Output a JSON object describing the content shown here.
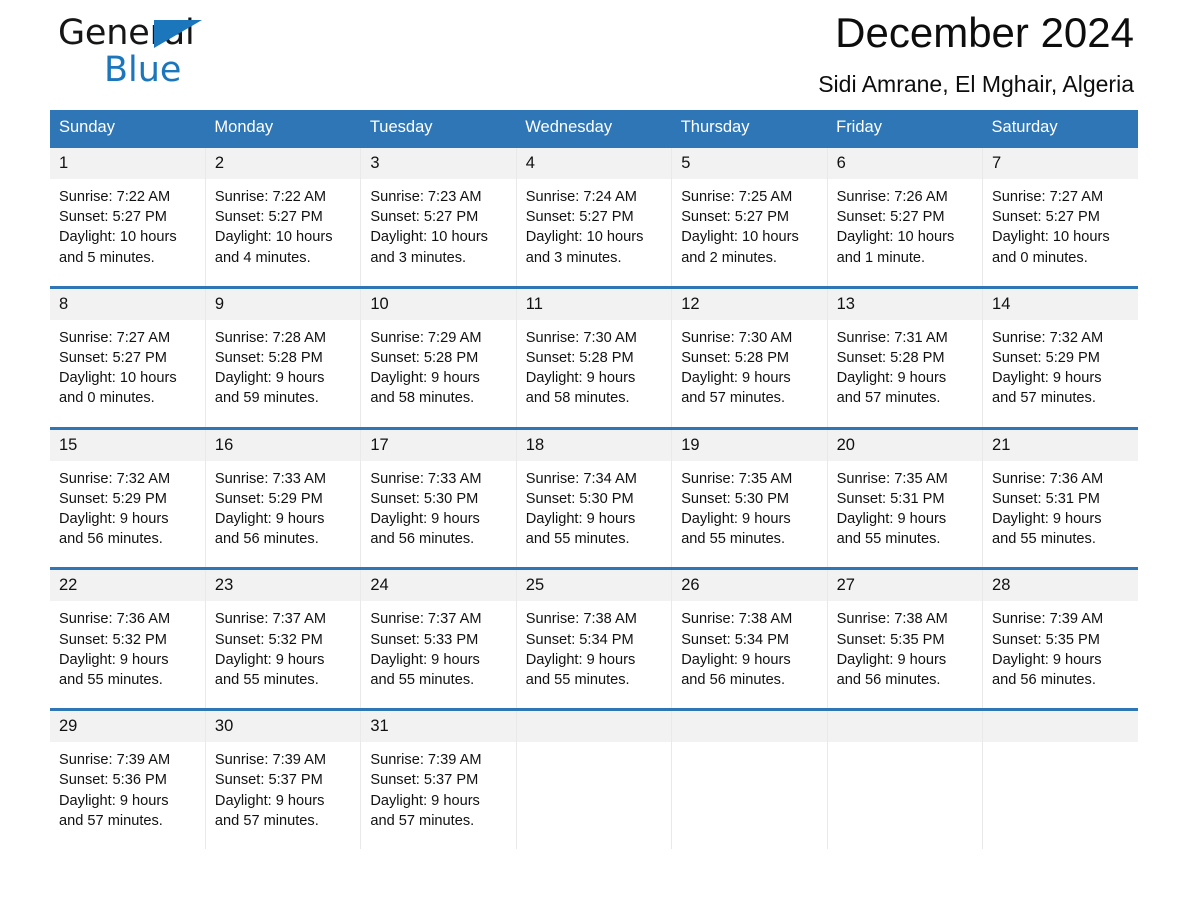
{
  "brand": {
    "name_part1": "General",
    "name_part2": "Blue",
    "triangle_icon": "triangle-icon",
    "accent_color": "#1b76bc"
  },
  "header": {
    "title": "December 2024",
    "subtitle": "Sidi Amrane, El Mghair, Algeria"
  },
  "calendar": {
    "header_bg": "#2e76b6",
    "daynum_bg": "#f2f2f2",
    "weekdays": [
      "Sunday",
      "Monday",
      "Tuesday",
      "Wednesday",
      "Thursday",
      "Friday",
      "Saturday"
    ],
    "weeks": [
      [
        {
          "day": "1",
          "sunrise": "Sunrise: 7:22 AM",
          "sunset": "Sunset: 5:27 PM",
          "daylight_line1": "Daylight: 10 hours",
          "daylight_line2": "and 5 minutes."
        },
        {
          "day": "2",
          "sunrise": "Sunrise: 7:22 AM",
          "sunset": "Sunset: 5:27 PM",
          "daylight_line1": "Daylight: 10 hours",
          "daylight_line2": "and 4 minutes."
        },
        {
          "day": "3",
          "sunrise": "Sunrise: 7:23 AM",
          "sunset": "Sunset: 5:27 PM",
          "daylight_line1": "Daylight: 10 hours",
          "daylight_line2": "and 3 minutes."
        },
        {
          "day": "4",
          "sunrise": "Sunrise: 7:24 AM",
          "sunset": "Sunset: 5:27 PM",
          "daylight_line1": "Daylight: 10 hours",
          "daylight_line2": "and 3 minutes."
        },
        {
          "day": "5",
          "sunrise": "Sunrise: 7:25 AM",
          "sunset": "Sunset: 5:27 PM",
          "daylight_line1": "Daylight: 10 hours",
          "daylight_line2": "and 2 minutes."
        },
        {
          "day": "6",
          "sunrise": "Sunrise: 7:26 AM",
          "sunset": "Sunset: 5:27 PM",
          "daylight_line1": "Daylight: 10 hours",
          "daylight_line2": "and 1 minute."
        },
        {
          "day": "7",
          "sunrise": "Sunrise: 7:27 AM",
          "sunset": "Sunset: 5:27 PM",
          "daylight_line1": "Daylight: 10 hours",
          "daylight_line2": "and 0 minutes."
        }
      ],
      [
        {
          "day": "8",
          "sunrise": "Sunrise: 7:27 AM",
          "sunset": "Sunset: 5:27 PM",
          "daylight_line1": "Daylight: 10 hours",
          "daylight_line2": "and 0 minutes."
        },
        {
          "day": "9",
          "sunrise": "Sunrise: 7:28 AM",
          "sunset": "Sunset: 5:28 PM",
          "daylight_line1": "Daylight: 9 hours",
          "daylight_line2": "and 59 minutes."
        },
        {
          "day": "10",
          "sunrise": "Sunrise: 7:29 AM",
          "sunset": "Sunset: 5:28 PM",
          "daylight_line1": "Daylight: 9 hours",
          "daylight_line2": "and 58 minutes."
        },
        {
          "day": "11",
          "sunrise": "Sunrise: 7:30 AM",
          "sunset": "Sunset: 5:28 PM",
          "daylight_line1": "Daylight: 9 hours",
          "daylight_line2": "and 58 minutes."
        },
        {
          "day": "12",
          "sunrise": "Sunrise: 7:30 AM",
          "sunset": "Sunset: 5:28 PM",
          "daylight_line1": "Daylight: 9 hours",
          "daylight_line2": "and 57 minutes."
        },
        {
          "day": "13",
          "sunrise": "Sunrise: 7:31 AM",
          "sunset": "Sunset: 5:28 PM",
          "daylight_line1": "Daylight: 9 hours",
          "daylight_line2": "and 57 minutes."
        },
        {
          "day": "14",
          "sunrise": "Sunrise: 7:32 AM",
          "sunset": "Sunset: 5:29 PM",
          "daylight_line1": "Daylight: 9 hours",
          "daylight_line2": "and 57 minutes."
        }
      ],
      [
        {
          "day": "15",
          "sunrise": "Sunrise: 7:32 AM",
          "sunset": "Sunset: 5:29 PM",
          "daylight_line1": "Daylight: 9 hours",
          "daylight_line2": "and 56 minutes."
        },
        {
          "day": "16",
          "sunrise": "Sunrise: 7:33 AM",
          "sunset": "Sunset: 5:29 PM",
          "daylight_line1": "Daylight: 9 hours",
          "daylight_line2": "and 56 minutes."
        },
        {
          "day": "17",
          "sunrise": "Sunrise: 7:33 AM",
          "sunset": "Sunset: 5:30 PM",
          "daylight_line1": "Daylight: 9 hours",
          "daylight_line2": "and 56 minutes."
        },
        {
          "day": "18",
          "sunrise": "Sunrise: 7:34 AM",
          "sunset": "Sunset: 5:30 PM",
          "daylight_line1": "Daylight: 9 hours",
          "daylight_line2": "and 55 minutes."
        },
        {
          "day": "19",
          "sunrise": "Sunrise: 7:35 AM",
          "sunset": "Sunset: 5:30 PM",
          "daylight_line1": "Daylight: 9 hours",
          "daylight_line2": "and 55 minutes."
        },
        {
          "day": "20",
          "sunrise": "Sunrise: 7:35 AM",
          "sunset": "Sunset: 5:31 PM",
          "daylight_line1": "Daylight: 9 hours",
          "daylight_line2": "and 55 minutes."
        },
        {
          "day": "21",
          "sunrise": "Sunrise: 7:36 AM",
          "sunset": "Sunset: 5:31 PM",
          "daylight_line1": "Daylight: 9 hours",
          "daylight_line2": "and 55 minutes."
        }
      ],
      [
        {
          "day": "22",
          "sunrise": "Sunrise: 7:36 AM",
          "sunset": "Sunset: 5:32 PM",
          "daylight_line1": "Daylight: 9 hours",
          "daylight_line2": "and 55 minutes."
        },
        {
          "day": "23",
          "sunrise": "Sunrise: 7:37 AM",
          "sunset": "Sunset: 5:32 PM",
          "daylight_line1": "Daylight: 9 hours",
          "daylight_line2": "and 55 minutes."
        },
        {
          "day": "24",
          "sunrise": "Sunrise: 7:37 AM",
          "sunset": "Sunset: 5:33 PM",
          "daylight_line1": "Daylight: 9 hours",
          "daylight_line2": "and 55 minutes."
        },
        {
          "day": "25",
          "sunrise": "Sunrise: 7:38 AM",
          "sunset": "Sunset: 5:34 PM",
          "daylight_line1": "Daylight: 9 hours",
          "daylight_line2": "and 55 minutes."
        },
        {
          "day": "26",
          "sunrise": "Sunrise: 7:38 AM",
          "sunset": "Sunset: 5:34 PM",
          "daylight_line1": "Daylight: 9 hours",
          "daylight_line2": "and 56 minutes."
        },
        {
          "day": "27",
          "sunrise": "Sunrise: 7:38 AM",
          "sunset": "Sunset: 5:35 PM",
          "daylight_line1": "Daylight: 9 hours",
          "daylight_line2": "and 56 minutes."
        },
        {
          "day": "28",
          "sunrise": "Sunrise: 7:39 AM",
          "sunset": "Sunset: 5:35 PM",
          "daylight_line1": "Daylight: 9 hours",
          "daylight_line2": "and 56 minutes."
        }
      ],
      [
        {
          "day": "29",
          "sunrise": "Sunrise: 7:39 AM",
          "sunset": "Sunset: 5:36 PM",
          "daylight_line1": "Daylight: 9 hours",
          "daylight_line2": "and 57 minutes."
        },
        {
          "day": "30",
          "sunrise": "Sunrise: 7:39 AM",
          "sunset": "Sunset: 5:37 PM",
          "daylight_line1": "Daylight: 9 hours",
          "daylight_line2": "and 57 minutes."
        },
        {
          "day": "31",
          "sunrise": "Sunrise: 7:39 AM",
          "sunset": "Sunset: 5:37 PM",
          "daylight_line1": "Daylight: 9 hours",
          "daylight_line2": "and 57 minutes."
        },
        {
          "day": "",
          "sunrise": "",
          "sunset": "",
          "daylight_line1": "",
          "daylight_line2": ""
        },
        {
          "day": "",
          "sunrise": "",
          "sunset": "",
          "daylight_line1": "",
          "daylight_line2": ""
        },
        {
          "day": "",
          "sunrise": "",
          "sunset": "",
          "daylight_line1": "",
          "daylight_line2": ""
        },
        {
          "day": "",
          "sunrise": "",
          "sunset": "",
          "daylight_line1": "",
          "daylight_line2": ""
        }
      ]
    ]
  }
}
